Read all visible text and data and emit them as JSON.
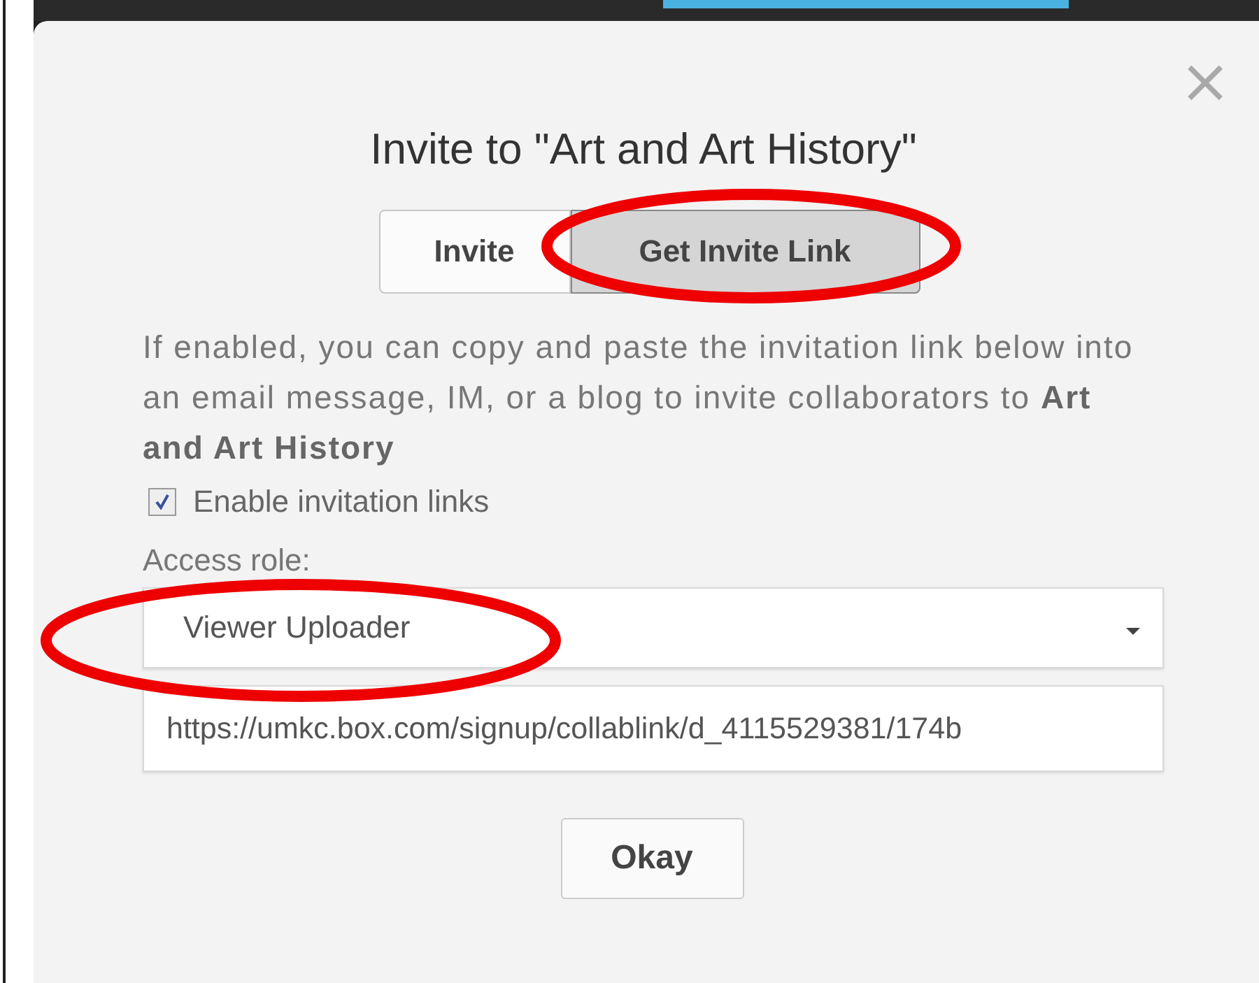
{
  "dialog": {
    "title": "Invite to \"Art and Art History\"",
    "close": "×",
    "tabs": [
      {
        "label": "Invite",
        "selected": false
      },
      {
        "label": "Get Invite Link",
        "selected": true
      }
    ],
    "description": "If enabled, you can copy and paste the invitation link below into an email message, IM, or a blog to invite collaborators to **Art and Art History**",
    "enable_links": {
      "label": "Enable invitation links",
      "checked": true
    },
    "access_role": {
      "label": "Access role:",
      "value": "Viewer Uploader"
    },
    "link_field": {
      "value": "https://umkc.box.com/signup/collablink/d_4115529381/174b"
    },
    "buttons": [
      "Okay"
    ]
  }
}
